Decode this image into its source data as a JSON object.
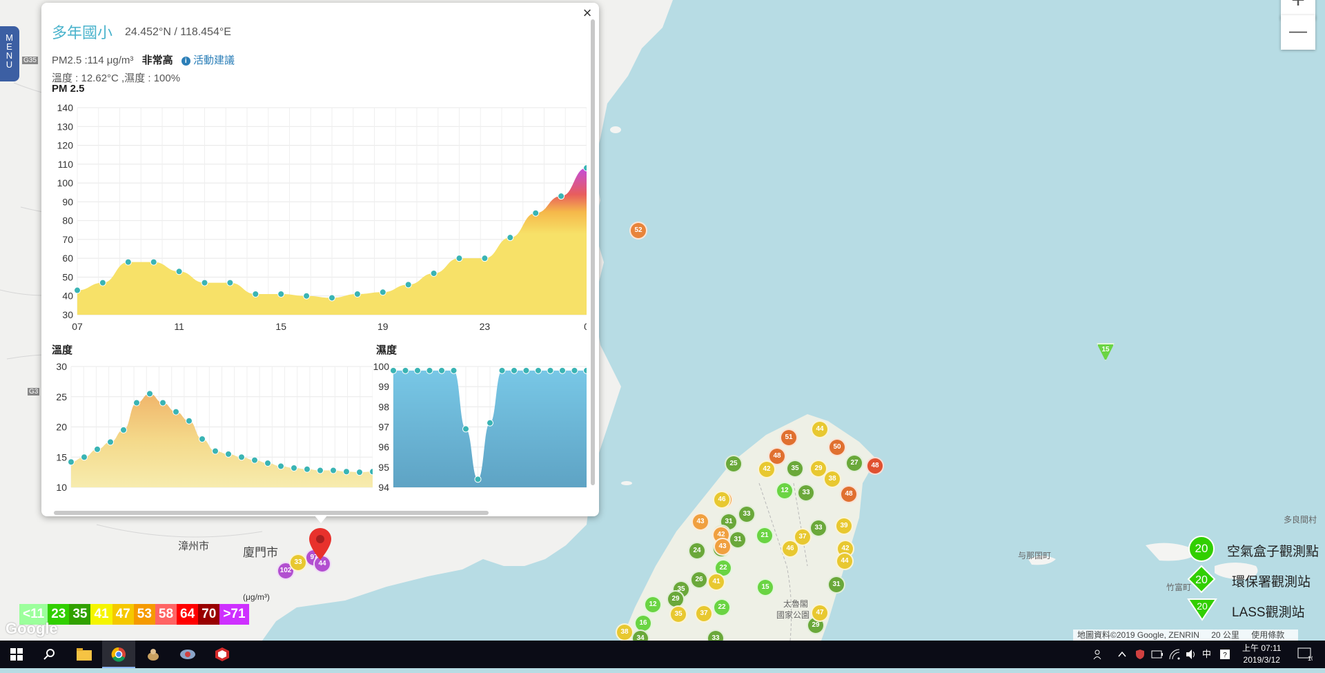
{
  "menu": {
    "letters": [
      "M",
      "E",
      "N",
      "U"
    ]
  },
  "zoom": {
    "in_label": "+",
    "out_label": "—"
  },
  "popup": {
    "close_label": "×",
    "station_name": "多年國小",
    "coords": "24.452°N / 118.454°E",
    "pm_text": "PM2.5 :114 μg/m³",
    "level_text": "非常高",
    "info_icon_text": "i",
    "advice_link": "活動建議",
    "env_text": "溫度 : 12.62°C ,濕度 : 100%"
  },
  "charts": {
    "pm25": {
      "title": "PM 2.5",
      "ylim": [
        30,
        140
      ]
    },
    "temp": {
      "title": "溫度",
      "ylim": [
        10,
        30
      ]
    },
    "humidity": {
      "title": "濕度",
      "ylim": [
        94,
        100
      ]
    }
  },
  "chart_data": [
    {
      "type": "area",
      "title": "PM 2.5",
      "x_ticks": [
        "07",
        "11",
        "15",
        "19",
        "23",
        "0"
      ],
      "y_ticks": [
        30,
        40,
        50,
        60,
        70,
        80,
        90,
        100,
        110,
        120,
        130,
        140
      ],
      "ylim": [
        30,
        140
      ],
      "series": [
        {
          "values": [
            43,
            47,
            58,
            58,
            53,
            47,
            47,
            41,
            41,
            40,
            39,
            41,
            42,
            46,
            52,
            60,
            60,
            71,
            84,
            93,
            108
          ]
        }
      ]
    },
    {
      "type": "area",
      "title": "溫度",
      "y_ticks": [
        10,
        15,
        20,
        25,
        30
      ],
      "ylim": [
        10,
        30
      ],
      "series": [
        {
          "values": [
            14.2,
            15,
            16.3,
            17.5,
            19.5,
            24,
            25.5,
            24,
            22.5,
            21,
            18,
            16,
            15.5,
            15,
            14.5,
            14,
            13.5,
            13.2,
            13,
            12.8,
            12.8,
            12.6,
            12.5,
            12.6
          ]
        }
      ]
    },
    {
      "type": "area",
      "title": "濕度",
      "y_ticks": [
        94,
        95,
        96,
        97,
        98,
        99,
        100
      ],
      "ylim": [
        94,
        100
      ],
      "series": [
        {
          "values": [
            99.8,
            99.8,
            99.8,
            99.8,
            99.8,
            99.8,
            96.9,
            94.4,
            97.2,
            99.8,
            99.8,
            99.8,
            99.8,
            99.8,
            99.8,
            99.8,
            99.8
          ]
        }
      ]
    }
  ],
  "legend": {
    "unit": "(μg/m³)",
    "items": [
      {
        "label": "<11",
        "color": "#9cff9c"
      },
      {
        "label": "23",
        "color": "#31cf00"
      },
      {
        "label": "35",
        "color": "#31a100"
      },
      {
        "label": "41",
        "color": "#f5f500"
      },
      {
        "label": "47",
        "color": "#f5c800"
      },
      {
        "label": "53",
        "color": "#f59a00"
      },
      {
        "label": "58",
        "color": "#ff6464"
      },
      {
        "label": "64",
        "color": "#ff0000"
      },
      {
        "label": "70",
        "color": "#990000"
      },
      {
        "label": ">71",
        "color": "#ce30ff"
      }
    ]
  },
  "station_legend": {
    "airbox": {
      "label": "空氣盒子觀測點",
      "value": "20"
    },
    "epa": {
      "label": "環保署觀測站",
      "value": "20"
    },
    "lass": {
      "label": "LASS觀測站",
      "value": "20"
    }
  },
  "map": {
    "google_logo": "Google",
    "attribution": "地圖資料©2019 Google, ZENRIN",
    "scale": "20 公里",
    "terms": "使用條款",
    "road_labels": [
      "G35",
      "G3"
    ],
    "places": [
      {
        "name": "漳州市",
        "cls": ""
      },
      {
        "name": "廈門市",
        "cls": ""
      },
      {
        "name": "与那国町",
        "cls": "small"
      },
      {
        "name": "竹富町",
        "cls": "small"
      },
      {
        "name": "多良間村",
        "cls": "small"
      },
      {
        "name": "太魯閣",
        "cls": "small"
      },
      {
        "name": "國家公園",
        "cls": "small"
      }
    ],
    "markers": [
      {
        "v": "52",
        "c": "#e8843a"
      },
      {
        "v": "15",
        "c": "#6ad443"
      },
      {
        "v": "97",
        "c": "#b24fd0"
      },
      {
        "v": "102",
        "c": "#b24fd0"
      },
      {
        "v": "33",
        "c": "#e8c830"
      },
      {
        "v": "44",
        "c": "#b24fd0"
      },
      {
        "v": "51",
        "c": "#e07030"
      },
      {
        "v": "44",
        "c": "#e8c830"
      },
      {
        "v": "50",
        "c": "#e07030"
      },
      {
        "v": "27",
        "c": "#6aa83a"
      },
      {
        "v": "48",
        "c": "#e05030"
      },
      {
        "v": "25",
        "c": "#6aa83a"
      },
      {
        "v": "48",
        "c": "#e07030"
      },
      {
        "v": "42",
        "c": "#e8c830"
      },
      {
        "v": "35",
        "c": "#6aa83a"
      },
      {
        "v": "29",
        "c": "#e8c830"
      },
      {
        "v": "44",
        "c": "#f0a040"
      },
      {
        "v": "46",
        "c": "#e8c830"
      },
      {
        "v": "12",
        "c": "#6ad443"
      },
      {
        "v": "33",
        "c": "#6aa83a"
      },
      {
        "v": "38",
        "c": "#e8c830"
      },
      {
        "v": "48",
        "c": "#e07030"
      },
      {
        "v": "43",
        "c": "#f0a040"
      },
      {
        "v": "31",
        "c": "#6aa83a"
      },
      {
        "v": "33",
        "c": "#6aa83a"
      },
      {
        "v": "26",
        "c": "#6aa83a"
      },
      {
        "v": "31",
        "c": "#6aa83a"
      },
      {
        "v": "21",
        "c": "#6ad443"
      },
      {
        "v": "37",
        "c": "#e8c830"
      },
      {
        "v": "33",
        "c": "#6aa83a"
      },
      {
        "v": "39",
        "c": "#e8c830"
      },
      {
        "v": "24",
        "c": "#6aa83a"
      },
      {
        "v": "27",
        "c": "#6aa83a"
      },
      {
        "v": "42",
        "c": "#f0a040"
      },
      {
        "v": "43",
        "c": "#f0a040"
      },
      {
        "v": "22",
        "c": "#6ad443"
      },
      {
        "v": "46",
        "c": "#e8c830"
      },
      {
        "v": "42",
        "c": "#e8c830"
      },
      {
        "v": "44",
        "c": "#e8c830"
      },
      {
        "v": "26",
        "c": "#6aa83a"
      },
      {
        "v": "41",
        "c": "#e8c830"
      },
      {
        "v": "15",
        "c": "#6ad443"
      },
      {
        "v": "31",
        "c": "#6aa83a"
      },
      {
        "v": "35",
        "c": "#6aa83a"
      },
      {
        "v": "29",
        "c": "#6aa83a"
      },
      {
        "v": "12",
        "c": "#6ad443"
      },
      {
        "v": "35",
        "c": "#e8c830"
      },
      {
        "v": "37",
        "c": "#e8c830"
      },
      {
        "v": "22",
        "c": "#6ad443"
      },
      {
        "v": "16",
        "c": "#6ad443"
      },
      {
        "v": "29",
        "c": "#6aa83a"
      },
      {
        "v": "38",
        "c": "#e8c830"
      },
      {
        "v": "34",
        "c": "#6aa83a"
      },
      {
        "v": "33",
        "c": "#6aa83a"
      },
      {
        "v": "47",
        "c": "#e8c830"
      }
    ]
  },
  "taskbar": {
    "apps": [
      "start-icon",
      "search-icon",
      "file-explorer-icon",
      "chrome-icon",
      "app-icon-1",
      "app-icon-2",
      "app-icon-3"
    ],
    "ime": "中",
    "time": "上午 07:11",
    "date": "2019/3/12",
    "notification_count": "10"
  }
}
